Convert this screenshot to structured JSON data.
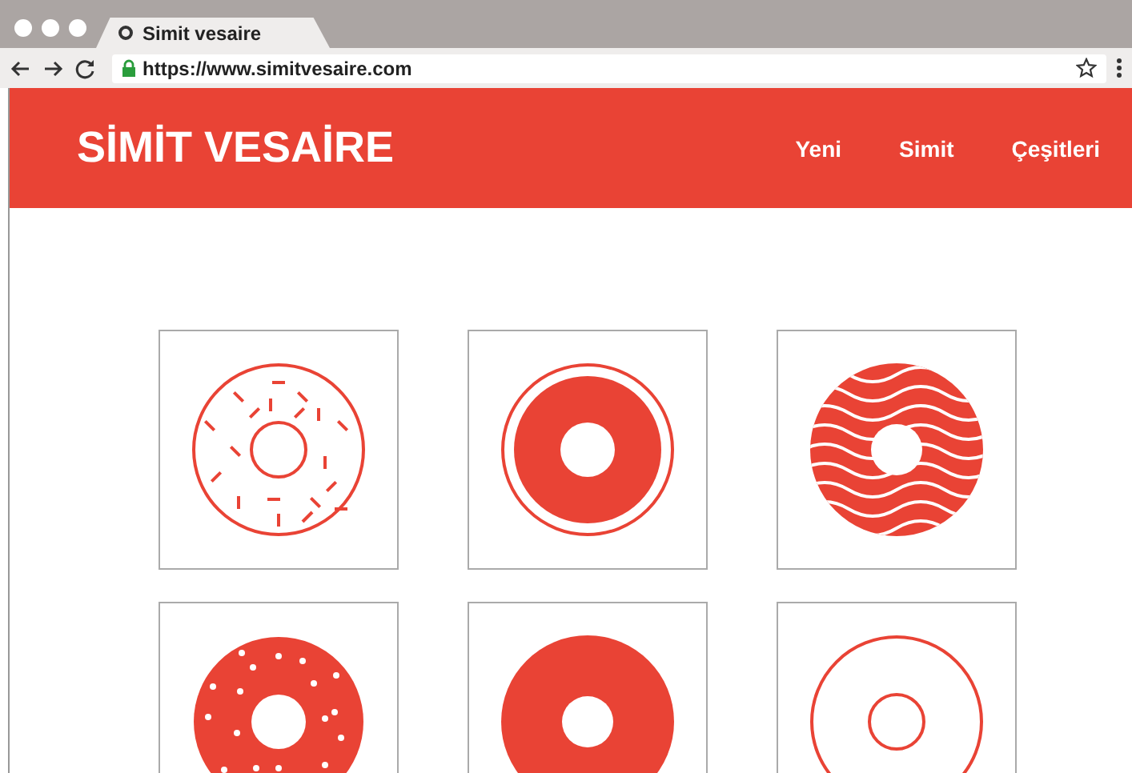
{
  "browser": {
    "tab_title": "Simit vesaire",
    "url": "https://www.simitvesaire.com"
  },
  "header": {
    "logo": "SİMİT VESAİRE",
    "nav": [
      {
        "label": "Yeni"
      },
      {
        "label": "Simit"
      },
      {
        "label": "Çeşitleri"
      }
    ]
  },
  "products": [
    {
      "kind": "sprinkles"
    },
    {
      "kind": "ring"
    },
    {
      "kind": "waves"
    },
    {
      "kind": "dots"
    },
    {
      "kind": "solid"
    },
    {
      "kind": "outline"
    }
  ]
}
